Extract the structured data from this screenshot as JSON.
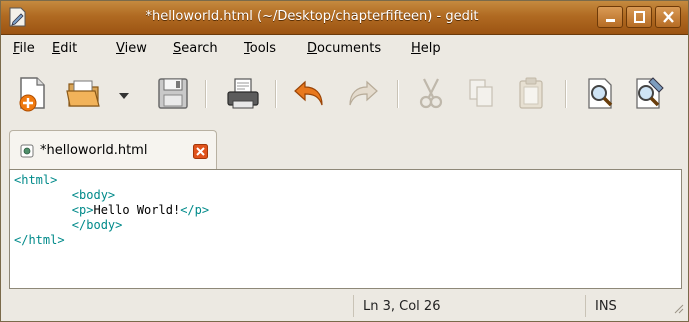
{
  "window": {
    "title": "*helloworld.html (~/Desktop/chapterfifteen) - gedit",
    "controls": [
      "minimize",
      "maximize",
      "close"
    ]
  },
  "menubar": {
    "file": {
      "mnemonic": "F",
      "rest": "ile"
    },
    "edit": {
      "mnemonic": "E",
      "rest": "dit"
    },
    "view": {
      "mnemonic": "V",
      "rest": "iew"
    },
    "search": {
      "mnemonic": "S",
      "rest": "earch"
    },
    "tools": {
      "mnemonic": "T",
      "rest": "ools"
    },
    "documents": {
      "mnemonic": "D",
      "rest": "ocuments"
    },
    "help": {
      "mnemonic": "H",
      "rest": "elp"
    }
  },
  "toolbar": {
    "icons": [
      "new-document-icon",
      "open-folder-icon",
      "open-recent-dropdown-icon",
      "save-icon",
      "print-icon",
      "undo-icon",
      "redo-icon",
      "cut-icon",
      "copy-icon",
      "paste-icon",
      "find-icon",
      "find-replace-icon"
    ]
  },
  "tabs": [
    {
      "label": "*helloworld.html",
      "icon": "document-icon",
      "close_icon": "close-icon"
    }
  ],
  "editor": {
    "lines": [
      {
        "indent": "",
        "open_tag": "<html>",
        "text": "",
        "close_tag": ""
      },
      {
        "indent": "        ",
        "open_tag": "<body>",
        "text": "",
        "close_tag": ""
      },
      {
        "indent": "        ",
        "open_tag": "<p>",
        "text": "Hello World!",
        "close_tag": "</p>"
      },
      {
        "indent": "        ",
        "open_tag": "</body>",
        "text": "",
        "close_tag": ""
      },
      {
        "indent": "",
        "open_tag": "</html>",
        "text": "",
        "close_tag": ""
      }
    ]
  },
  "statusbar": {
    "position": "Ln 3, Col 26",
    "mode": "INS"
  },
  "colors": {
    "titlebar": "#b06a22",
    "tag": "#008a8a",
    "background": "#ece9e2"
  }
}
